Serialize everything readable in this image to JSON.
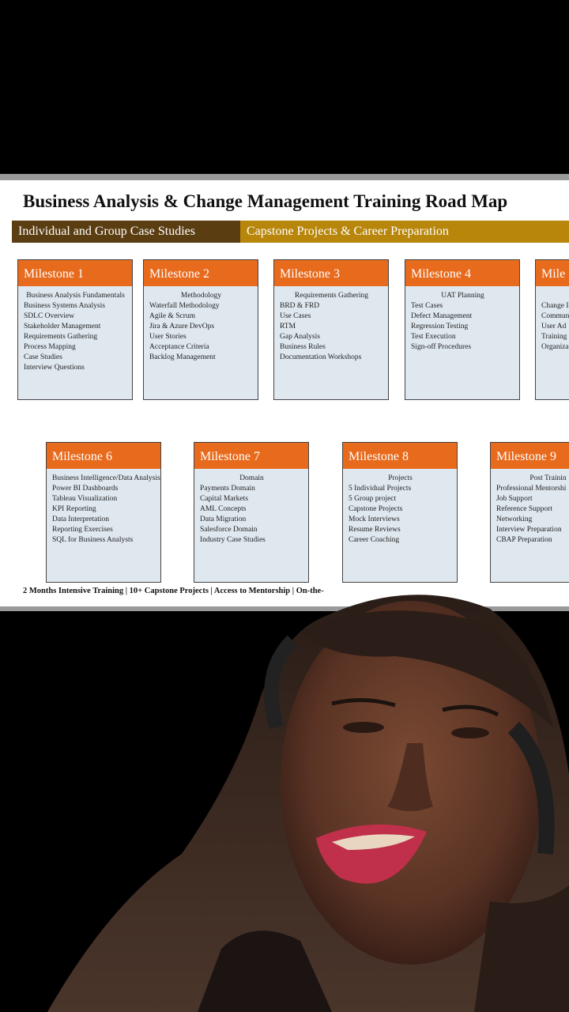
{
  "slide": {
    "title": "Business Analysis & Change Management Training Road Map",
    "band_left": "Individual and Group Case Studies",
    "band_right": "Capstone Projects & Career Preparation",
    "footer": "2 Months Intensive Training | 10+ Capstone Projects | Access to Mentorship | On-the-"
  },
  "milestones": [
    {
      "title": "Milestone 1",
      "subtitle": "Business Analysis Fundamentals",
      "items": [
        "Business Systems Analysis",
        "SDLC Overview",
        "Stakeholder Management",
        "Requirements Gathering",
        "Process Mapping",
        "Case Studies",
        "Interview Questions"
      ]
    },
    {
      "title": "Milestone 2",
      "subtitle": "Methodology",
      "items": [
        "Waterfall Methodology",
        "Agile & Scrum",
        "Jira & Azure DevOps",
        "User Stories",
        "Acceptance Criteria",
        "Backlog Management"
      ]
    },
    {
      "title": "Milestone 3",
      "subtitle": "Requirements Gathering",
      "items": [
        "BRD & FRD",
        "Use Cases",
        "RTM",
        "Gap Analysis",
        "Business Rules",
        "Documentation Workshops"
      ]
    },
    {
      "title": "Milestone 4",
      "subtitle": "UAT Planning",
      "items": [
        "Test Cases",
        "Defect Management",
        "Regression Testing",
        "Test Execution",
        "Sign-off Procedures"
      ]
    },
    {
      "title": "Mile",
      "subtitle": "C",
      "items": [
        "Change I",
        "Commun",
        "User Ad",
        "Training",
        "Organiza"
      ]
    },
    {
      "title": "Milestone 6",
      "subtitle": "Business Intelligence/Data Analysis",
      "items": [
        "Power BI Dashboards",
        "Tableau Visualization",
        "KPI Reporting",
        "Data Interpretation",
        "Reporting Exercises",
        "SQL for Business Analysts"
      ]
    },
    {
      "title": "Milestone 7",
      "subtitle": "Domain",
      "items": [
        "Payments Domain",
        "Capital Markets",
        "AML Concepts",
        "Data Migration",
        "Salesforce Domain",
        "Industry Case Studies"
      ]
    },
    {
      "title": "Milestone 8",
      "subtitle": "Projects",
      "items": [
        "5 Individual Projects",
        "5 Group project",
        "Capstone Projects",
        "Mock Interviews",
        "Resume Reviews",
        "Career Coaching"
      ]
    },
    {
      "title": "Milestone 9",
      "subtitle": "Post Trainin",
      "items": [
        "Professional Mentorshi",
        "Job Support",
        "Reference Support",
        "Networking",
        "Interview Preparation",
        "CBAP Preparation"
      ]
    }
  ]
}
